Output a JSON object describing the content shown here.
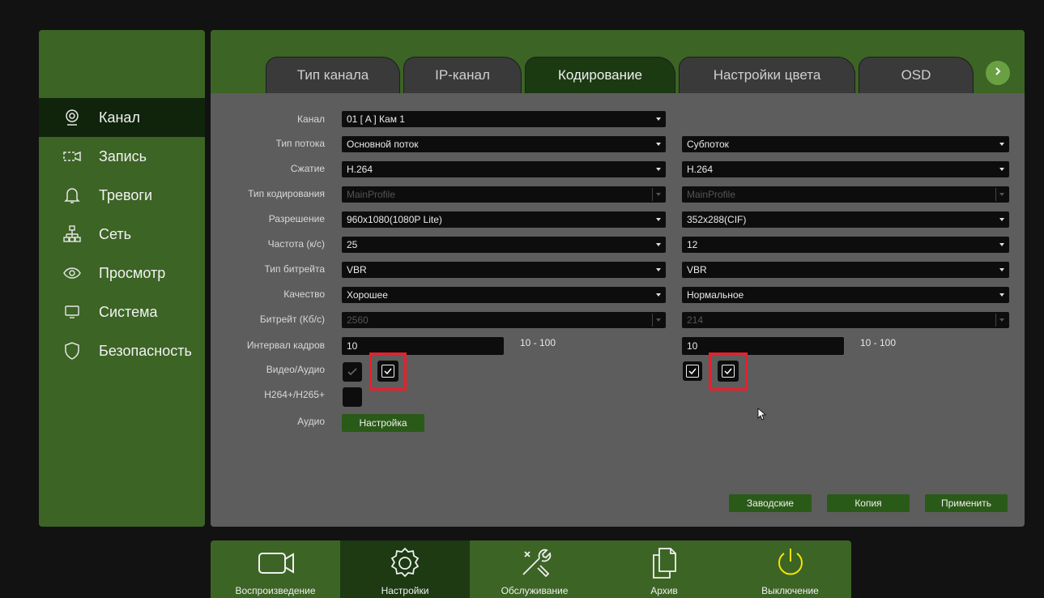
{
  "sidebar": {
    "items": [
      {
        "label": "Канал",
        "icon": "camera-icon",
        "active": true
      },
      {
        "label": "Запись",
        "icon": "record-icon",
        "active": false
      },
      {
        "label": "Тревоги",
        "icon": "bell-icon",
        "active": false
      },
      {
        "label": "Сеть",
        "icon": "network-icon",
        "active": false
      },
      {
        "label": "Просмотр",
        "icon": "eye-icon",
        "active": false
      },
      {
        "label": "Система",
        "icon": "monitor-icon",
        "active": false
      },
      {
        "label": "Безопасность",
        "icon": "shield-icon",
        "active": false
      }
    ]
  },
  "tabs": [
    {
      "label": "Тип канала",
      "active": false
    },
    {
      "label": "IP-канал",
      "active": false
    },
    {
      "label": "Кодирование",
      "active": true
    },
    {
      "label": "Настройки цвета",
      "active": false
    },
    {
      "label": "OSD",
      "active": false
    }
  ],
  "form": {
    "labels": {
      "channel": "Канал",
      "stream_type": "Тип потока",
      "compression": "Сжатие",
      "encoding_type": "Тип кодирования",
      "resolution": "Разрешение",
      "frame_rate": "Частота (к/с)",
      "bitrate_type": "Тип битрейта",
      "quality": "Качество",
      "bitrate": "Битрейт (Кб/с)",
      "frame_interval": "Интервал кадров",
      "video_audio": "Видео/Аудио",
      "h264plus": "H264+/H265+",
      "audio": "Аудио"
    },
    "channel": "01 [ A ] Кам 1",
    "main": {
      "stream_type": "Основной поток",
      "compression": "H.264",
      "encoding_type": "MainProfile",
      "resolution": "960x1080(1080P Lite)",
      "frame_rate": "25",
      "bitrate_type": "VBR",
      "quality": "Хорошее",
      "bitrate": "2560",
      "frame_interval": "10",
      "range": "10 - 100",
      "video_checked": true,
      "audio_checked": true
    },
    "sub": {
      "stream_type": "Субпоток",
      "compression": "H.264",
      "encoding_type": "MainProfile",
      "resolution": "352x288(CIF)",
      "frame_rate": "12",
      "bitrate_type": "VBR",
      "quality": "Нормальное",
      "bitrate": "214",
      "frame_interval": "10",
      "range": "10 - 100",
      "video_checked": true,
      "audio_checked": true
    },
    "h264plus_checked": false,
    "audio_setup_label": "Настройка"
  },
  "actions": {
    "default_label": "Заводские",
    "copy_label": "Копия",
    "apply_label": "Применить"
  },
  "bottom_bar": [
    {
      "label": "Воспроизведение",
      "icon": "playback-camera-icon",
      "active": false
    },
    {
      "label": "Настройки",
      "icon": "gear-icon",
      "active": true
    },
    {
      "label": "Обслуживание",
      "icon": "tools-icon",
      "active": false
    },
    {
      "label": "Архив",
      "icon": "files-icon",
      "active": false
    },
    {
      "label": "Выключение",
      "icon": "power-icon",
      "active": false
    }
  ],
  "colors": {
    "panel_green": "#3c6425",
    "active_green": "#0f240b",
    "content_gray": "#5d5d5d",
    "highlight_red": "#e8202a"
  }
}
